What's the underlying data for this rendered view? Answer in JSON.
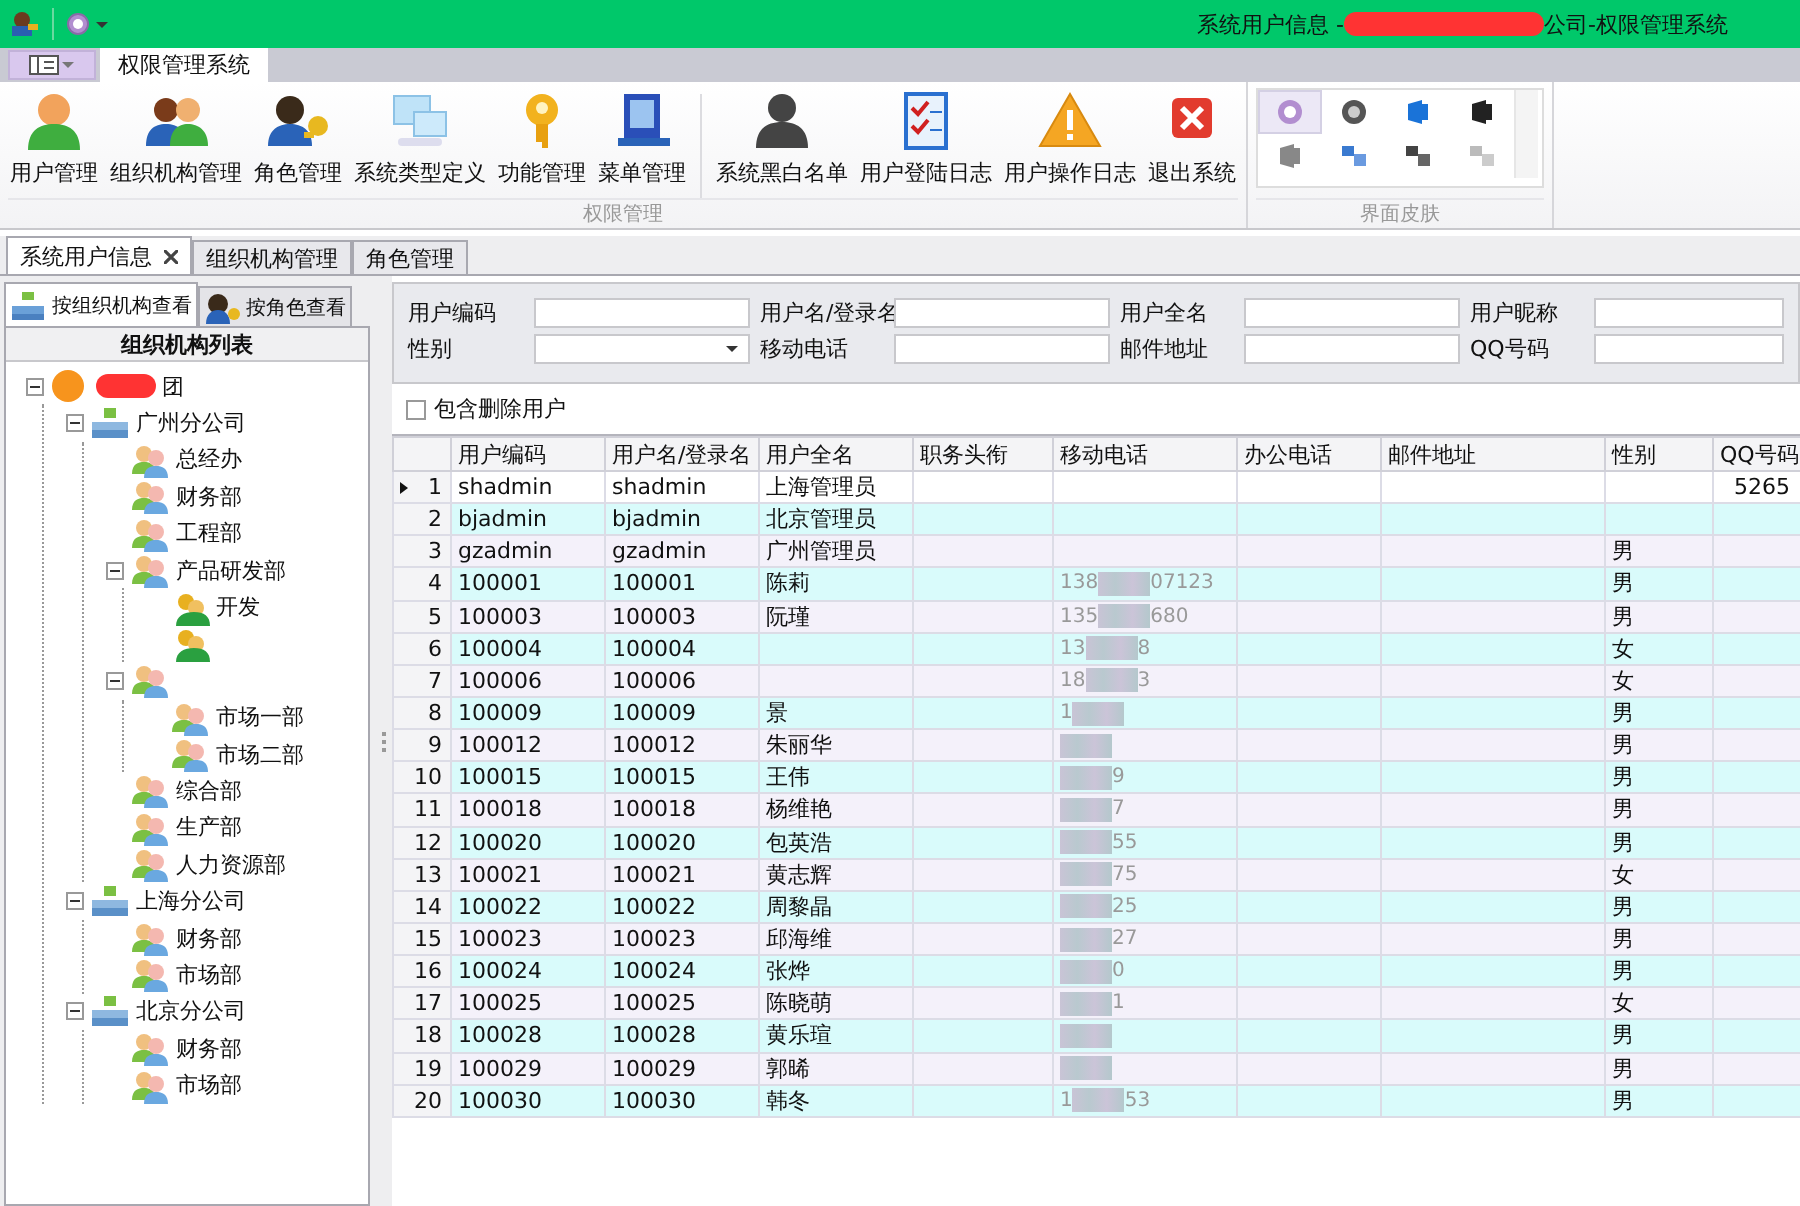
{
  "window": {
    "title_start": "系统用户信息 - ",
    "title_end": "公司-权限管理系统",
    "redacted": true
  },
  "ribbon": {
    "tabs": [
      {
        "label": "权限管理系统",
        "selected": true
      }
    ],
    "groups": [
      {
        "label": "权限管理",
        "items": [
          {
            "label": "用户管理",
            "separator_before": false
          },
          {
            "label": "组织机构管理",
            "separator_before": false
          },
          {
            "label": "角色管理",
            "separator_before": false
          },
          {
            "label": "系统类型定义",
            "separator_before": false
          },
          {
            "label": "功能管理",
            "separator_before": false
          },
          {
            "label": "菜单管理",
            "separator_before": false
          },
          {
            "label": "系统黑白名单",
            "separator_before": true
          },
          {
            "label": "用户登陆日志",
            "separator_before": false
          },
          {
            "label": "用户操作日志",
            "separator_before": false
          },
          {
            "label": "退出系统",
            "separator_before": false
          }
        ]
      }
    ],
    "skins": {
      "label": "界面皮肤",
      "items": [
        {
          "selected": true
        },
        {
          "selected": false
        },
        {
          "selected": false
        },
        {
          "selected": false
        },
        {
          "selected": false
        },
        {
          "selected": false
        },
        {
          "selected": false
        },
        {
          "selected": false
        }
      ]
    }
  },
  "doc_tabs": [
    {
      "label": "系统用户信息",
      "selected": true,
      "closable": true
    },
    {
      "label": "组织机构管理",
      "selected": false,
      "closable": false
    },
    {
      "label": "角色管理",
      "selected": false,
      "closable": false
    }
  ],
  "left_panel": {
    "tabs": [
      {
        "label": "按组织机构查看",
        "selected": true
      },
      {
        "label": "按角色查看",
        "selected": false
      }
    ],
    "header": "组织机构列表",
    "tree": [
      {
        "kind": "root",
        "label": "团",
        "redacted": true,
        "expanded": true,
        "children": [
          {
            "kind": "company",
            "label": "广州分公司",
            "expanded": true,
            "children": [
              {
                "kind": "department",
                "label": "总经办"
              },
              {
                "kind": "department",
                "label": "财务部"
              },
              {
                "kind": "department",
                "label": "工程部"
              },
              {
                "kind": "department",
                "label": "产品研发部",
                "expanded": true,
                "children": [
                  {
                    "kind": "team",
                    "label": "开发"
                  },
                  {
                    "kind": "team"
                  }
                ]
              },
              {
                "kind": "department",
                "expanded": true,
                "children": [
                  {
                    "kind": "department",
                    "label": "市场一部"
                  },
                  {
                    "kind": "department",
                    "label": "市场二部"
                  }
                ]
              },
              {
                "kind": "department",
                "label": "综合部"
              },
              {
                "kind": "department",
                "label": "生产部"
              },
              {
                "kind": "department",
                "label": "人力资源部"
              }
            ]
          },
          {
            "kind": "company",
            "label": "上海分公司",
            "expanded": true,
            "children": [
              {
                "kind": "department",
                "label": "财务部"
              },
              {
                "kind": "department",
                "label": "市场部"
              }
            ]
          },
          {
            "kind": "company",
            "label": "北京分公司",
            "expanded": true,
            "children": [
              {
                "kind": "department",
                "label": "财务部"
              },
              {
                "kind": "department",
                "label": "市场部"
              }
            ]
          }
        ]
      }
    ]
  },
  "filters": [
    {
      "label": "用户编码",
      "kind": "text"
    },
    {
      "label": "用户名/登录名",
      "kind": "text"
    },
    {
      "label": "用户全名",
      "kind": "text"
    },
    {
      "label": "用户昵称",
      "kind": "text"
    },
    {
      "label": "性别",
      "kind": "dropdown"
    },
    {
      "label": "移动电话",
      "kind": "text"
    },
    {
      "label": "邮件地址",
      "kind": "text"
    },
    {
      "label": "QQ号码",
      "kind": "text"
    }
  ],
  "include_deleted": {
    "label": "包含删除用户",
    "checked": false
  },
  "table": {
    "columns": [
      "用户编码",
      "用户名/登录名",
      "用户全名",
      "职务头衔",
      "移动电话",
      "办公电话",
      "邮件地址",
      "性别",
      "QQ号码"
    ],
    "rows": [
      {
        "index": "1",
        "code": "shadmin",
        "login": "shadmin",
        "name": "上海管理员",
        "qq": "5265",
        "selected": true
      },
      {
        "index": "2",
        "code": "bjadmin",
        "login": "bjadmin",
        "name": "北京管理员",
        "selected": false
      },
      {
        "index": "3",
        "code": "gzadmin",
        "login": "gzadmin",
        "name": "广州管理员",
        "gender": "男",
        "selected": false
      },
      {
        "index": "4",
        "code": "100001",
        "login": "100001",
        "name": "陈莉",
        "mobile": {
          "start": "138",
          "end": "07123"
        },
        "gender": "男",
        "selected": false
      },
      {
        "index": "5",
        "code": "100003",
        "login": "100003",
        "name": "阮瑾",
        "mobile": {
          "start": "135",
          "end": "680"
        },
        "gender": "男",
        "selected": false
      },
      {
        "index": "6",
        "code": "100004",
        "login": "100004",
        "mobile": {
          "start": "13",
          "end": "8"
        },
        "gender": "女",
        "selected": false
      },
      {
        "index": "7",
        "code": "100006",
        "login": "100006",
        "mobile": {
          "start": "18",
          "end": "3"
        },
        "gender": "女",
        "selected": false
      },
      {
        "index": "8",
        "code": "100009",
        "login": "100009",
        "name": "景",
        "mobile": {
          "start": "1"
        },
        "gender": "男",
        "selected": false
      },
      {
        "index": "9",
        "code": "100012",
        "login": "100012",
        "name": "朱丽华",
        "mobile": {},
        "gender": "男",
        "selected": false
      },
      {
        "index": "10",
        "code": "100015",
        "login": "100015",
        "name": "王伟",
        "mobile": {
          "end": "9"
        },
        "gender": "男",
        "selected": false
      },
      {
        "index": "11",
        "code": "100018",
        "login": "100018",
        "name": "杨维艳",
        "mobile": {
          "end": "7"
        },
        "gender": "男",
        "selected": false
      },
      {
        "index": "12",
        "code": "100020",
        "login": "100020",
        "name": "包英浩",
        "mobile": {
          "end": "55"
        },
        "gender": "男",
        "selected": false
      },
      {
        "index": "13",
        "code": "100021",
        "login": "100021",
        "name": "黄志辉",
        "mobile": {
          "end": "75"
        },
        "gender": "女",
        "selected": false
      },
      {
        "index": "14",
        "code": "100022",
        "login": "100022",
        "name": "周黎晶",
        "mobile": {
          "end": "25"
        },
        "gender": "男",
        "selected": false
      },
      {
        "index": "15",
        "code": "100023",
        "login": "100023",
        "name": "邱海维",
        "mobile": {
          "end": "27"
        },
        "gender": "男",
        "selected": false
      },
      {
        "index": "16",
        "code": "100024",
        "login": "100024",
        "name": "张烨",
        "mobile": {
          "end": "0"
        },
        "gender": "男",
        "selected": false
      },
      {
        "index": "17",
        "code": "100025",
        "login": "100025",
        "name": "陈晓萌",
        "mobile": {
          "end": "1"
        },
        "gender": "女",
        "selected": false
      },
      {
        "index": "18",
        "code": "100028",
        "login": "100028",
        "name": "黄乐瑄",
        "mobile": {},
        "gender": "男",
        "selected": false
      },
      {
        "index": "19",
        "code": "100029",
        "login": "100029",
        "name": "郭晞",
        "mobile": {},
        "gender": "男",
        "selected": false
      },
      {
        "index": "20",
        "code": "100030",
        "login": "100030",
        "name": "韩冬",
        "mobile": {
          "start": "1",
          "end": "53"
        },
        "gender": "男",
        "selected": false
      }
    ]
  }
}
